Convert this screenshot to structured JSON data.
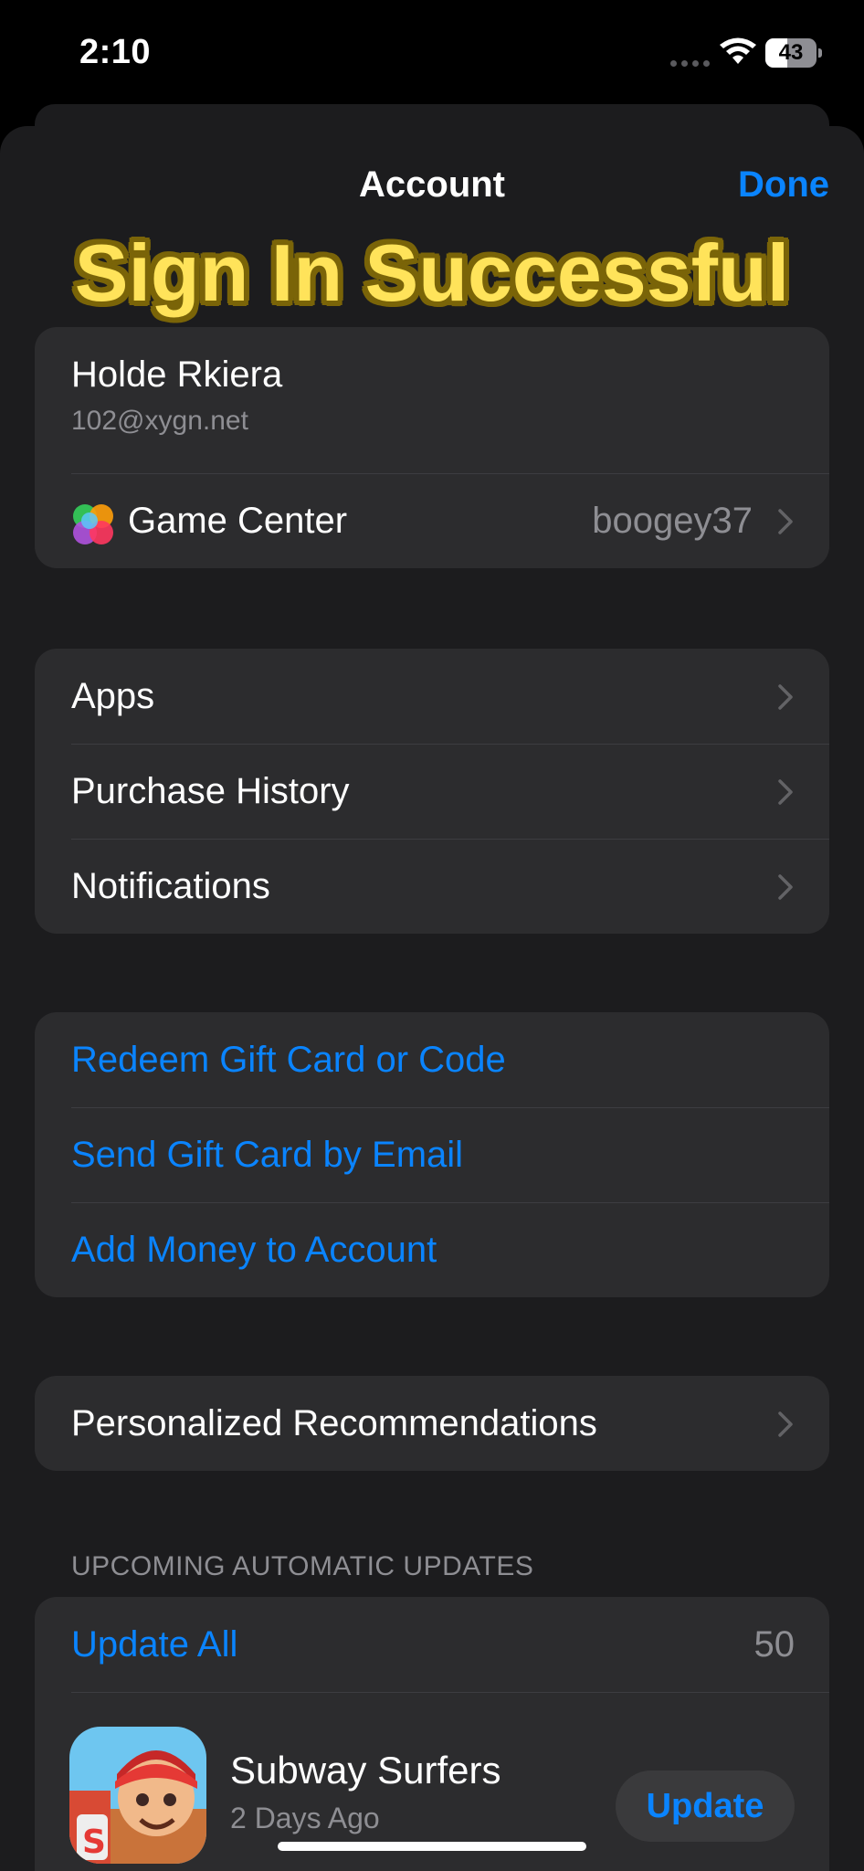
{
  "status_bar": {
    "time": "2:10",
    "battery_level": "43",
    "battery_fraction": 0.43
  },
  "nav": {
    "title": "Account",
    "done_label": "Done"
  },
  "overlay_banner": "Sign In Successful",
  "account": {
    "name": "Holde Rkiera",
    "email": "102@xygn.net",
    "game_center_label": "Game Center",
    "game_center_value": "boogey37"
  },
  "menu_group": {
    "items": [
      {
        "label": "Apps"
      },
      {
        "label": "Purchase History"
      },
      {
        "label": "Notifications"
      }
    ]
  },
  "gift_group": {
    "items": [
      {
        "label": "Redeem Gift Card or Code"
      },
      {
        "label": "Send Gift Card by Email"
      },
      {
        "label": "Add Money to Account"
      }
    ]
  },
  "recommendations": {
    "label": "Personalized Recommendations"
  },
  "updates": {
    "section_header": "UPCOMING AUTOMATIC UPDATES",
    "update_all_label": "Update All",
    "count": "50",
    "apps": [
      {
        "name": "Subway Surfers",
        "date": "2 Days Ago",
        "button_label": "Update"
      }
    ]
  },
  "colors": {
    "accent": "#0a84ff",
    "sheet_background": "#1c1c1e",
    "group_background": "#2c2c2e",
    "secondary_text": "#8e8e93",
    "banner_text": "#ffe35a"
  }
}
